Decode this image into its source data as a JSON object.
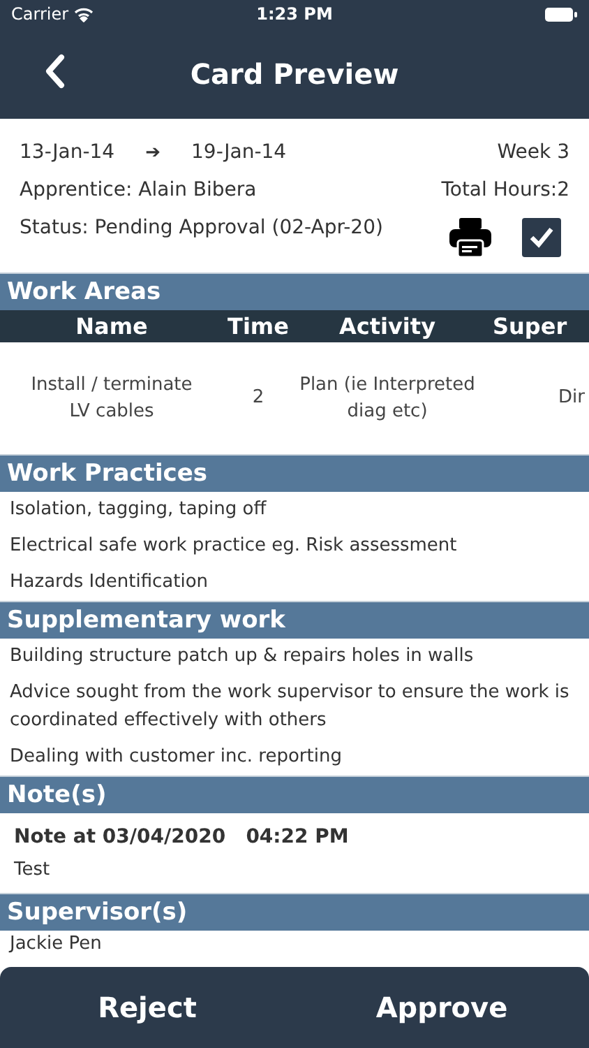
{
  "status_bar": {
    "carrier": "Carrier",
    "time": "1:23 PM"
  },
  "nav": {
    "title": "Card Preview"
  },
  "card": {
    "start_date": "13-Jan-14",
    "arrow": "➔",
    "end_date": "19-Jan-14",
    "week": "Week 3",
    "apprentice": "Apprentice: Alain Bibera",
    "total_hours": "Total Hours:2",
    "status": "Status: Pending Approval (02-Apr-20)",
    "approved_checked": true
  },
  "work_areas": {
    "title": "Work Areas",
    "columns": [
      "Name",
      "Time",
      "Activity",
      "Super"
    ],
    "rows": [
      [
        "Install / terminate LV cables",
        "2",
        "Plan (ie Interpreted diag etc)",
        "Dir"
      ]
    ]
  },
  "work_practices": {
    "title": "Work Practices",
    "items": [
      "Isolation, tagging, taping off",
      "Electrical safe work practice eg. Risk assessment",
      "Hazards Identification"
    ]
  },
  "supplementary_work": {
    "title": "Supplementary work",
    "items": [
      "Building structure patch up & repairs holes in walls",
      "Advice sought from the work supervisor to ensure the work is coordinated effectively with others",
      "Dealing with customer inc. reporting"
    ]
  },
  "notes": {
    "title": "Note(s)",
    "items": [
      {
        "heading": "Note at 03/04/2020   04:22 PM",
        "text": "Test"
      }
    ]
  },
  "supervisors": {
    "title": "Supervisor(s)",
    "items": [
      "Jackie Pen"
    ]
  },
  "actions": [
    "Reject",
    "Approve"
  ]
}
